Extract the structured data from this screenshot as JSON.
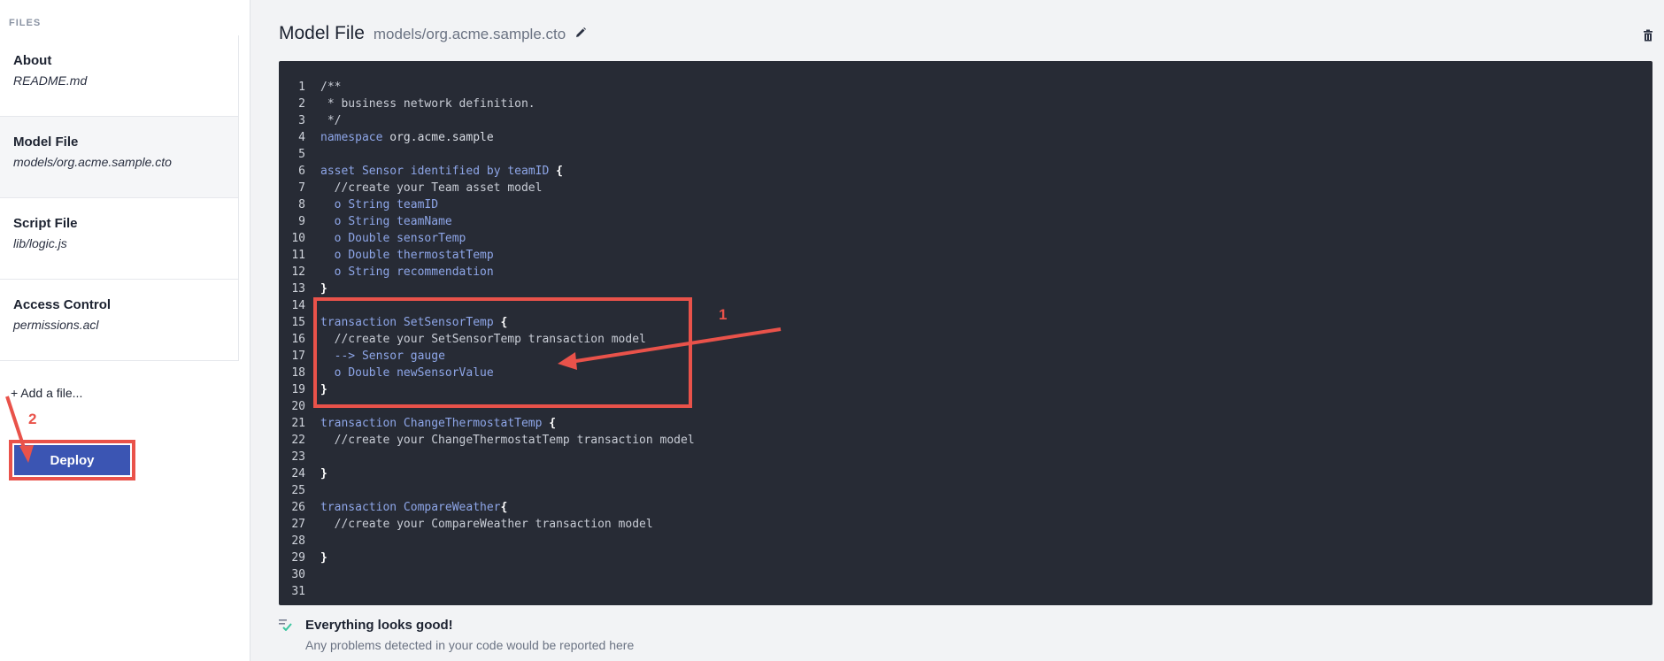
{
  "sidebar": {
    "header": "FILES",
    "files": [
      {
        "name": "About",
        "path": "README.md"
      },
      {
        "name": "Model File",
        "path": "models/org.acme.sample.cto"
      },
      {
        "name": "Script File",
        "path": "lib/logic.js"
      },
      {
        "name": "Access Control",
        "path": "permissions.acl"
      }
    ],
    "add_file_label": "+ Add a file...",
    "deploy_label": "Deploy"
  },
  "editor": {
    "title": "Model File",
    "path": "models/org.acme.sample.cto",
    "lines": [
      "/**",
      " * business network definition.",
      " */",
      "namespace org.acme.sample",
      "",
      "asset Sensor identified by teamID {",
      "  //create your Team asset model",
      "  o String teamID",
      "  o String teamName",
      "  o Double sensorTemp",
      "  o Double thermostatTemp",
      "  o String recommendation",
      "}",
      "",
      "transaction SetSensorTemp {",
      "  //create your SetSensorTemp transaction model",
      "  --> Sensor gauge",
      "  o Double newSensorValue",
      "}",
      "",
      "transaction ChangeThermostatTemp {",
      "  //create your ChangeThermostatTemp transaction model",
      "",
      "}",
      "",
      "transaction CompareWeather{",
      "  //create your CompareWeather transaction model",
      "",
      "}",
      "",
      ""
    ]
  },
  "status": {
    "title": "Everything looks good!",
    "subtitle": "Any problems detected in your code would be reported here"
  },
  "annotations": {
    "label_1": "1",
    "label_2": "2",
    "color": "#e9524a"
  },
  "icons": {
    "edit": "pencil-icon",
    "delete": "trash-icon",
    "status": "check-list-icon"
  },
  "colors": {
    "editor_bg": "#272b35",
    "keyword": "#8ea6e8",
    "deploy_button": "#3b55b3"
  }
}
